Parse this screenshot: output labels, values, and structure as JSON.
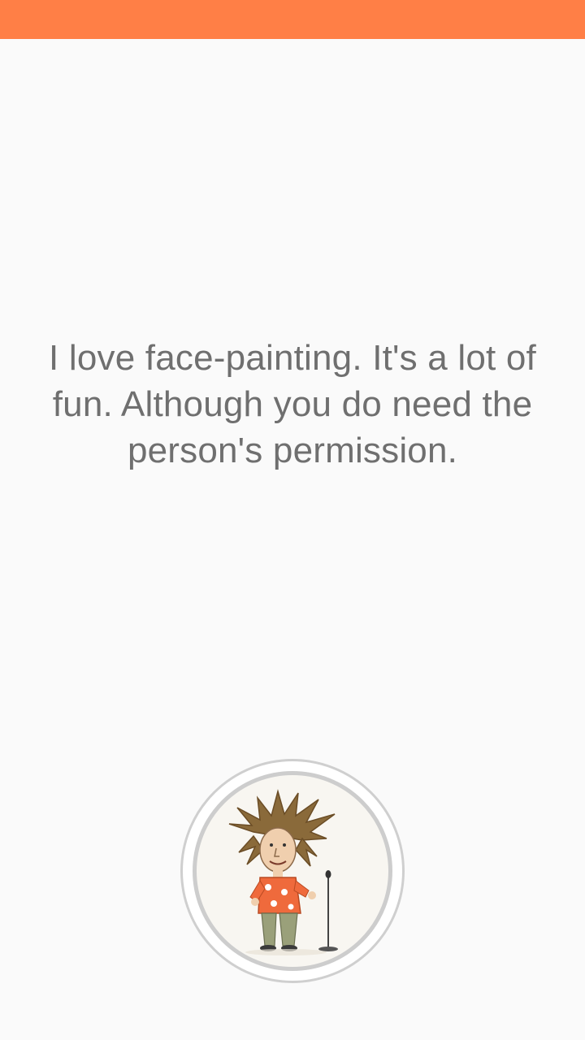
{
  "status_bar": {
    "color": "#ff7f46"
  },
  "quote": {
    "text": "I love face-painting. It's a lot of fun. Although you do need the person's permission.",
    "color": "#6f6f6f"
  },
  "avatar": {
    "icon": "comedian-caricature-icon"
  }
}
